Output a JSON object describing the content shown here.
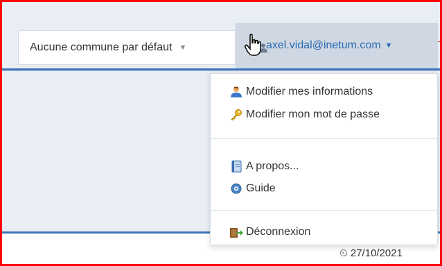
{
  "header": {
    "commune_select": "Aucune commune par défaut",
    "user_email": "axel.vidal@inetum.com"
  },
  "user_menu": {
    "items": [
      {
        "label": "Modifier mes informations",
        "icon": "user-icon"
      },
      {
        "label": "Modifier mon mot de passe",
        "icon": "key-icon"
      },
      {
        "label": "A propos...",
        "icon": "book-icon"
      },
      {
        "label": "Guide",
        "icon": "help-icon"
      },
      {
        "label": "Déconnexion",
        "icon": "logout-icon"
      }
    ]
  },
  "footer": {
    "date": "27/10/2021"
  },
  "colors": {
    "accent": "#2a6ab3",
    "highlight_border": "#ff0000"
  }
}
